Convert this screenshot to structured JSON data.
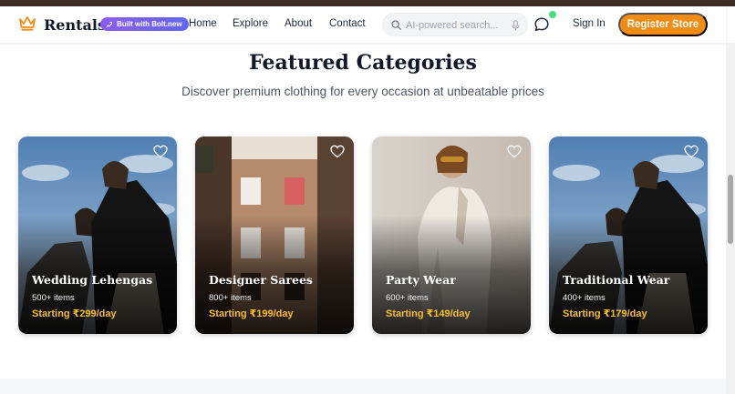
{
  "brand": {
    "name": "Rentals",
    "logo_icon": "crown-icon",
    "accent": "#f08c14"
  },
  "badge": {
    "label": "Built with Bolt.new",
    "icon": "bolt-icon",
    "color": "#8b5cf6"
  },
  "nav": {
    "links": [
      "Home",
      "Explore",
      "About",
      "Contact"
    ]
  },
  "search": {
    "placeholder": "AI-powered search...",
    "value": "",
    "icons": [
      "search-icon",
      "microphone-icon"
    ]
  },
  "header_actions": {
    "chat_icon": "chat-bubble-icon",
    "sign_in": "Sign In",
    "register": "Register Store"
  },
  "section": {
    "title": "Featured Categories",
    "subtitle": "Discover premium clothing for every occasion at unbeatable prices"
  },
  "categories": [
    {
      "name": "Wedding Lehengas",
      "count": "500+ items",
      "price": "Starting ₹299/day"
    },
    {
      "name": "Designer Sarees",
      "count": "800+ items",
      "price": "Starting ₹199/day"
    },
    {
      "name": "Party Wear",
      "count": "600+ items",
      "price": "Starting ₹149/day"
    },
    {
      "name": "Traditional Wear",
      "count": "400+ items",
      "price": "Starting ₹179/day"
    }
  ],
  "colors": {
    "price": "#fbbf24",
    "status_online": "#4ade80",
    "top_strip": "#3d2d25"
  }
}
